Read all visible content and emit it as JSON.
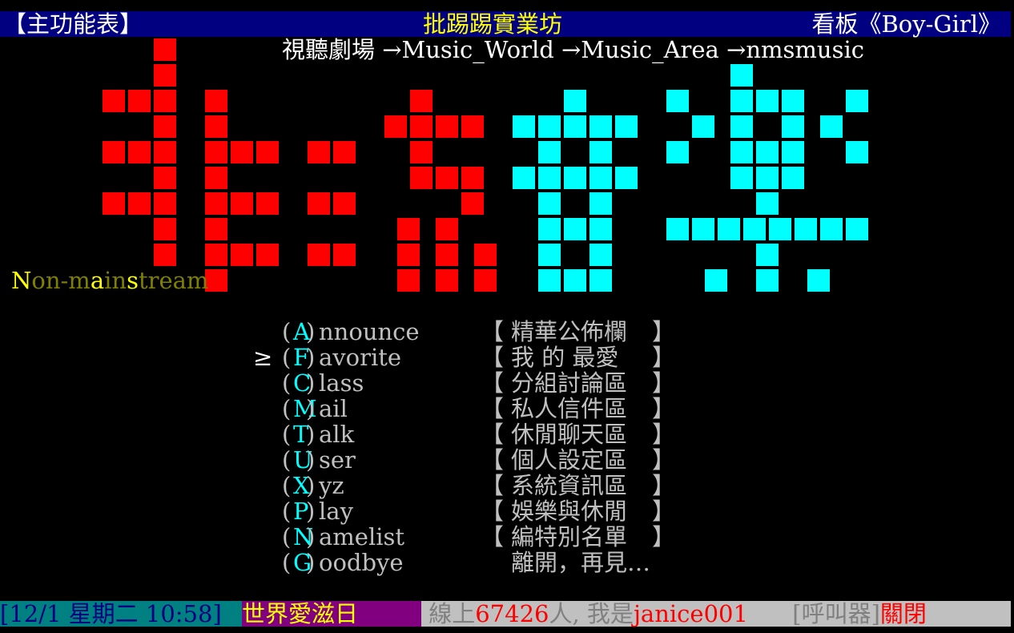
{
  "header": {
    "menu_title": "【主功能表】",
    "station_name": "批踢踢實業坊",
    "board_name": "看板《Boy-Girl》"
  },
  "breadcrumb": "視聽劇場 →Music_World →Music_Area →nmsmusic",
  "banner": {
    "tagline_parts": [
      "N",
      "on-m",
      "a",
      "in",
      "s",
      "tream"
    ],
    "colors": {
      "left_art": "#ff0000",
      "right_art": "#00ffff",
      "tagline_bright": "#ffff00",
      "tagline_dim": "#808000"
    }
  },
  "menu": {
    "cursor": "≥",
    "selected_index": 1,
    "items": [
      {
        "key": "A",
        "rest": "nnounce",
        "desc": "精華公佈欄",
        "bracketed": true
      },
      {
        "key": "F",
        "rest": "avorite",
        "desc": "我 的 最愛",
        "bracketed": true
      },
      {
        "key": "C",
        "rest": "lass",
        "desc": "分組討論區",
        "bracketed": true
      },
      {
        "key": "M",
        "rest": "ail",
        "desc": "私人信件區",
        "bracketed": true
      },
      {
        "key": "T",
        "rest": "alk",
        "desc": "休閒聊天區",
        "bracketed": true
      },
      {
        "key": "U",
        "rest": "ser",
        "desc": "個人設定區",
        "bracketed": true
      },
      {
        "key": "X",
        "rest": "yz",
        "desc": "系統資訊區",
        "bracketed": true
      },
      {
        "key": "P",
        "rest": "lay",
        "desc": "娛樂與休閒",
        "bracketed": true
      },
      {
        "key": "N",
        "rest": "amelist",
        "desc": "編特別名單",
        "bracketed": true
      },
      {
        "key": "G",
        "rest": "oodbye",
        "desc": "離開，再見…",
        "bracketed": false
      }
    ]
  },
  "status": {
    "datetime": "[12/1 星期二 10:58]",
    "holiday": "世界愛滋日",
    "online_prefix": "線上",
    "online_count": "67426",
    "online_suffix": "人, 我是",
    "user_id": "janice001",
    "pager_label": "[呼叫器]",
    "pager_state": "關閉"
  }
}
